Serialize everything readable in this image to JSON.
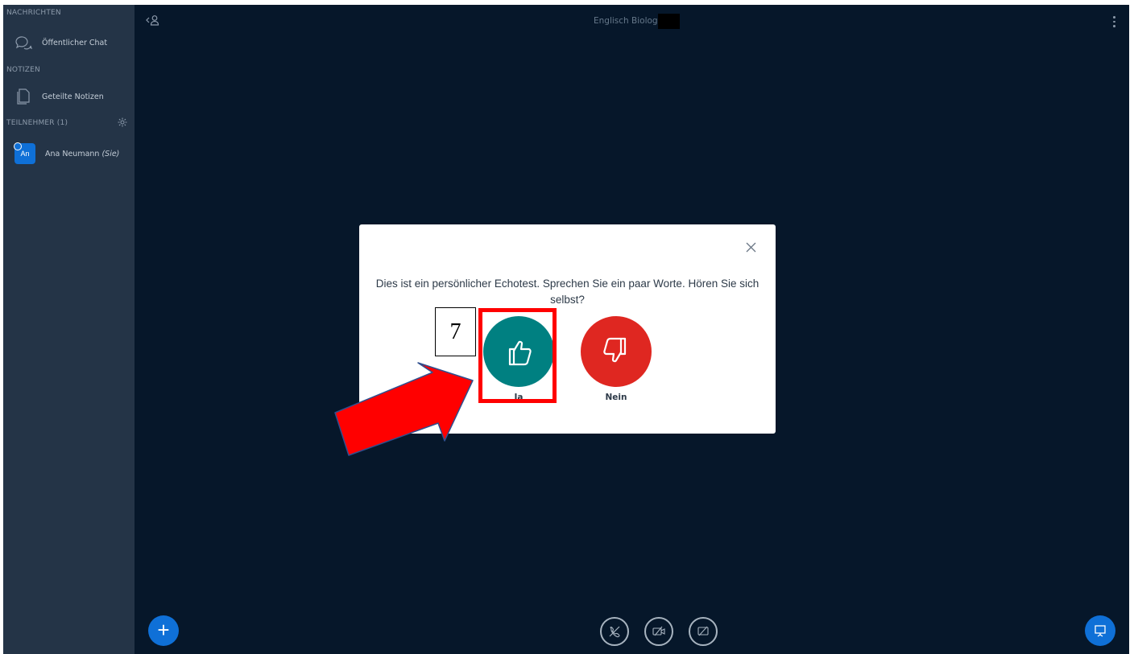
{
  "sidebar": {
    "messages_section": "NACHRICHTEN",
    "public_chat": "Öffentlicher Chat",
    "notes_section": "NOTIZEN",
    "shared_notes": "Geteilte Notizen",
    "participants_section": "TEILNEHMER (1)",
    "user": {
      "initials": "An",
      "name": "Ana Neumann",
      "you_suffix": "(Sie)"
    }
  },
  "header": {
    "meeting_title": "Englisch Biologie"
  },
  "dialog": {
    "message": "Dies ist ein persönlicher Echotest. Sprechen Sie ein paar Worte. Hören Sie sich selbst?",
    "yes_label": "Ja",
    "no_label": "Nein"
  },
  "annotation": {
    "step_number": "7"
  },
  "colors": {
    "background": "#06172A",
    "sidebar": "#243447",
    "primary": "#0F70D7",
    "yes": "#008081",
    "no": "#DF2721",
    "highlight": "#FF0000"
  }
}
